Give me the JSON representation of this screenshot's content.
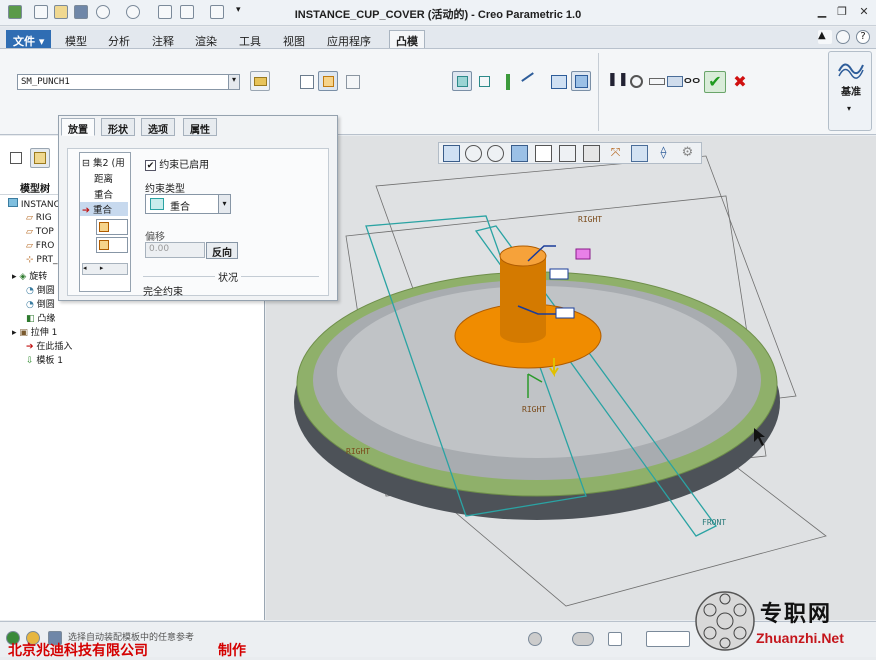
{
  "window": {
    "title": "INSTANCE_CUP_COVER (活动的) - Creo Parametric 1.0"
  },
  "menu_tabs": [
    "文件",
    "模型",
    "分析",
    "注释",
    "渲染",
    "工具",
    "视图",
    "应用程序",
    "凸模"
  ],
  "ribbon": {
    "sketch_value": "SM_PUNCH1",
    "datum_label": "基准"
  },
  "left_panel": {
    "model_tree_label": "模型树",
    "tree_items": [
      "INSTANC",
      "RIG",
      "TOP",
      "FRO",
      "PRT_",
      "旋转",
      "倒圆",
      "倒圆",
      "凸缘",
      "拉伸 1",
      "在此插入",
      "模板 1"
    ]
  },
  "placement_panel": {
    "tabs": [
      "放置",
      "形状",
      "选项",
      "属性"
    ],
    "set_items": [
      "集2 (用",
      "距离",
      "重合",
      "重合"
    ],
    "constraint_enabled": "约束已启用",
    "constraint_type_label": "约束类型",
    "constraint_type_value": "重合",
    "offset_label": "偏移",
    "offset_value": "0.00",
    "flip_label": "反向",
    "status_label": "状况",
    "status_value": "完全约束"
  },
  "graphics": {
    "datum_labels": [
      "RIGHT",
      "RIGHT",
      "FRONT",
      "RIGHT"
    ]
  },
  "status": {
    "company": "北京兆迪科技有限公司",
    "made_by": "制作",
    "message": "选择自动装配模板中的任意参考"
  },
  "watermark": {
    "line1": "专职网",
    "line2": "Zhuanzhi.Net"
  },
  "colors": {
    "accent": "#f08c00",
    "flange": "#8fb06a",
    "plane": "#2aa3a3",
    "ok": "#1f9a1f",
    "cancel": "#d01010"
  }
}
